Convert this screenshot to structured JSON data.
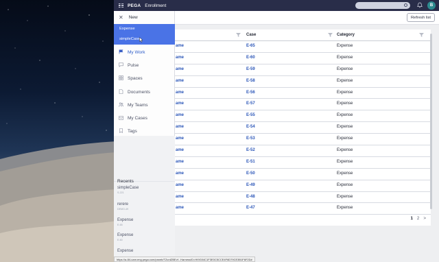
{
  "topbar": {
    "brand": "PEGA",
    "app_title": "Enrollment",
    "avatar_initial": "B"
  },
  "header": {
    "refresh_label": "Refresh list"
  },
  "table": {
    "columns": [
      "Case",
      "Category"
    ],
    "rows": [
      {
        "name": "ame",
        "id": "E-65",
        "category": "Expense"
      },
      {
        "name": "ame",
        "id": "E-60",
        "category": "Expense"
      },
      {
        "name": "ame",
        "id": "E-59",
        "category": "Expense"
      },
      {
        "name": "ame",
        "id": "E-58",
        "category": "Expense"
      },
      {
        "name": "ame",
        "id": "E-56",
        "category": "Expense"
      },
      {
        "name": "ame",
        "id": "E-57",
        "category": "Expense"
      },
      {
        "name": "ame",
        "id": "E-55",
        "category": "Expense"
      },
      {
        "name": "ame",
        "id": "E-54",
        "category": "Expense"
      },
      {
        "name": "ame",
        "id": "E-53",
        "category": "Expense"
      },
      {
        "name": "ame",
        "id": "E-52",
        "category": "Expense"
      },
      {
        "name": "ame",
        "id": "E-51",
        "category": "Expense"
      },
      {
        "name": "ame",
        "id": "E-50",
        "category": "Expense"
      },
      {
        "name": "ame",
        "id": "E-49",
        "category": "Expense"
      },
      {
        "name": "ame",
        "id": "E-48",
        "category": "Expense"
      },
      {
        "name": "ame",
        "id": "E-47",
        "category": "Expense"
      }
    ],
    "pagination": {
      "current": "1",
      "next_page": "2",
      "next_arrow": ">"
    }
  },
  "nav": {
    "new_label": "New",
    "case_types": [
      "Expense",
      "simpleCase"
    ],
    "items": [
      {
        "label": "My Work",
        "icon": "flag-icon"
      },
      {
        "label": "Pulse",
        "icon": "chat-icon"
      },
      {
        "label": "Spaces",
        "icon": "spaces-grid-icon"
      },
      {
        "label": "Documents",
        "icon": "document-icon"
      },
      {
        "label": "My Teams",
        "icon": "team-icon"
      },
      {
        "label": "My Cases",
        "icon": "cases-icon"
      },
      {
        "label": "Tags",
        "icon": "tag-icon"
      }
    ],
    "recents_title": "Recents",
    "recents": [
      {
        "title": "simpleCase",
        "subtitle": "S-221"
      },
      {
        "title": "rerere",
        "subtitle": "DEMO-49"
      },
      {
        "title": "Expense",
        "subtitle": "E-65"
      },
      {
        "title": "Expense",
        "subtitle": "E-60"
      },
      {
        "title": "Expense",
        "subtitle": ""
      }
    ]
  },
  "status_url": "https://a-84-cam.eng.pega.com/prweb/TZcrdZBEvf...Harness!D=HI9G04C1F3E0C5CCE4F6D79CE3B1F6F2D#"
}
